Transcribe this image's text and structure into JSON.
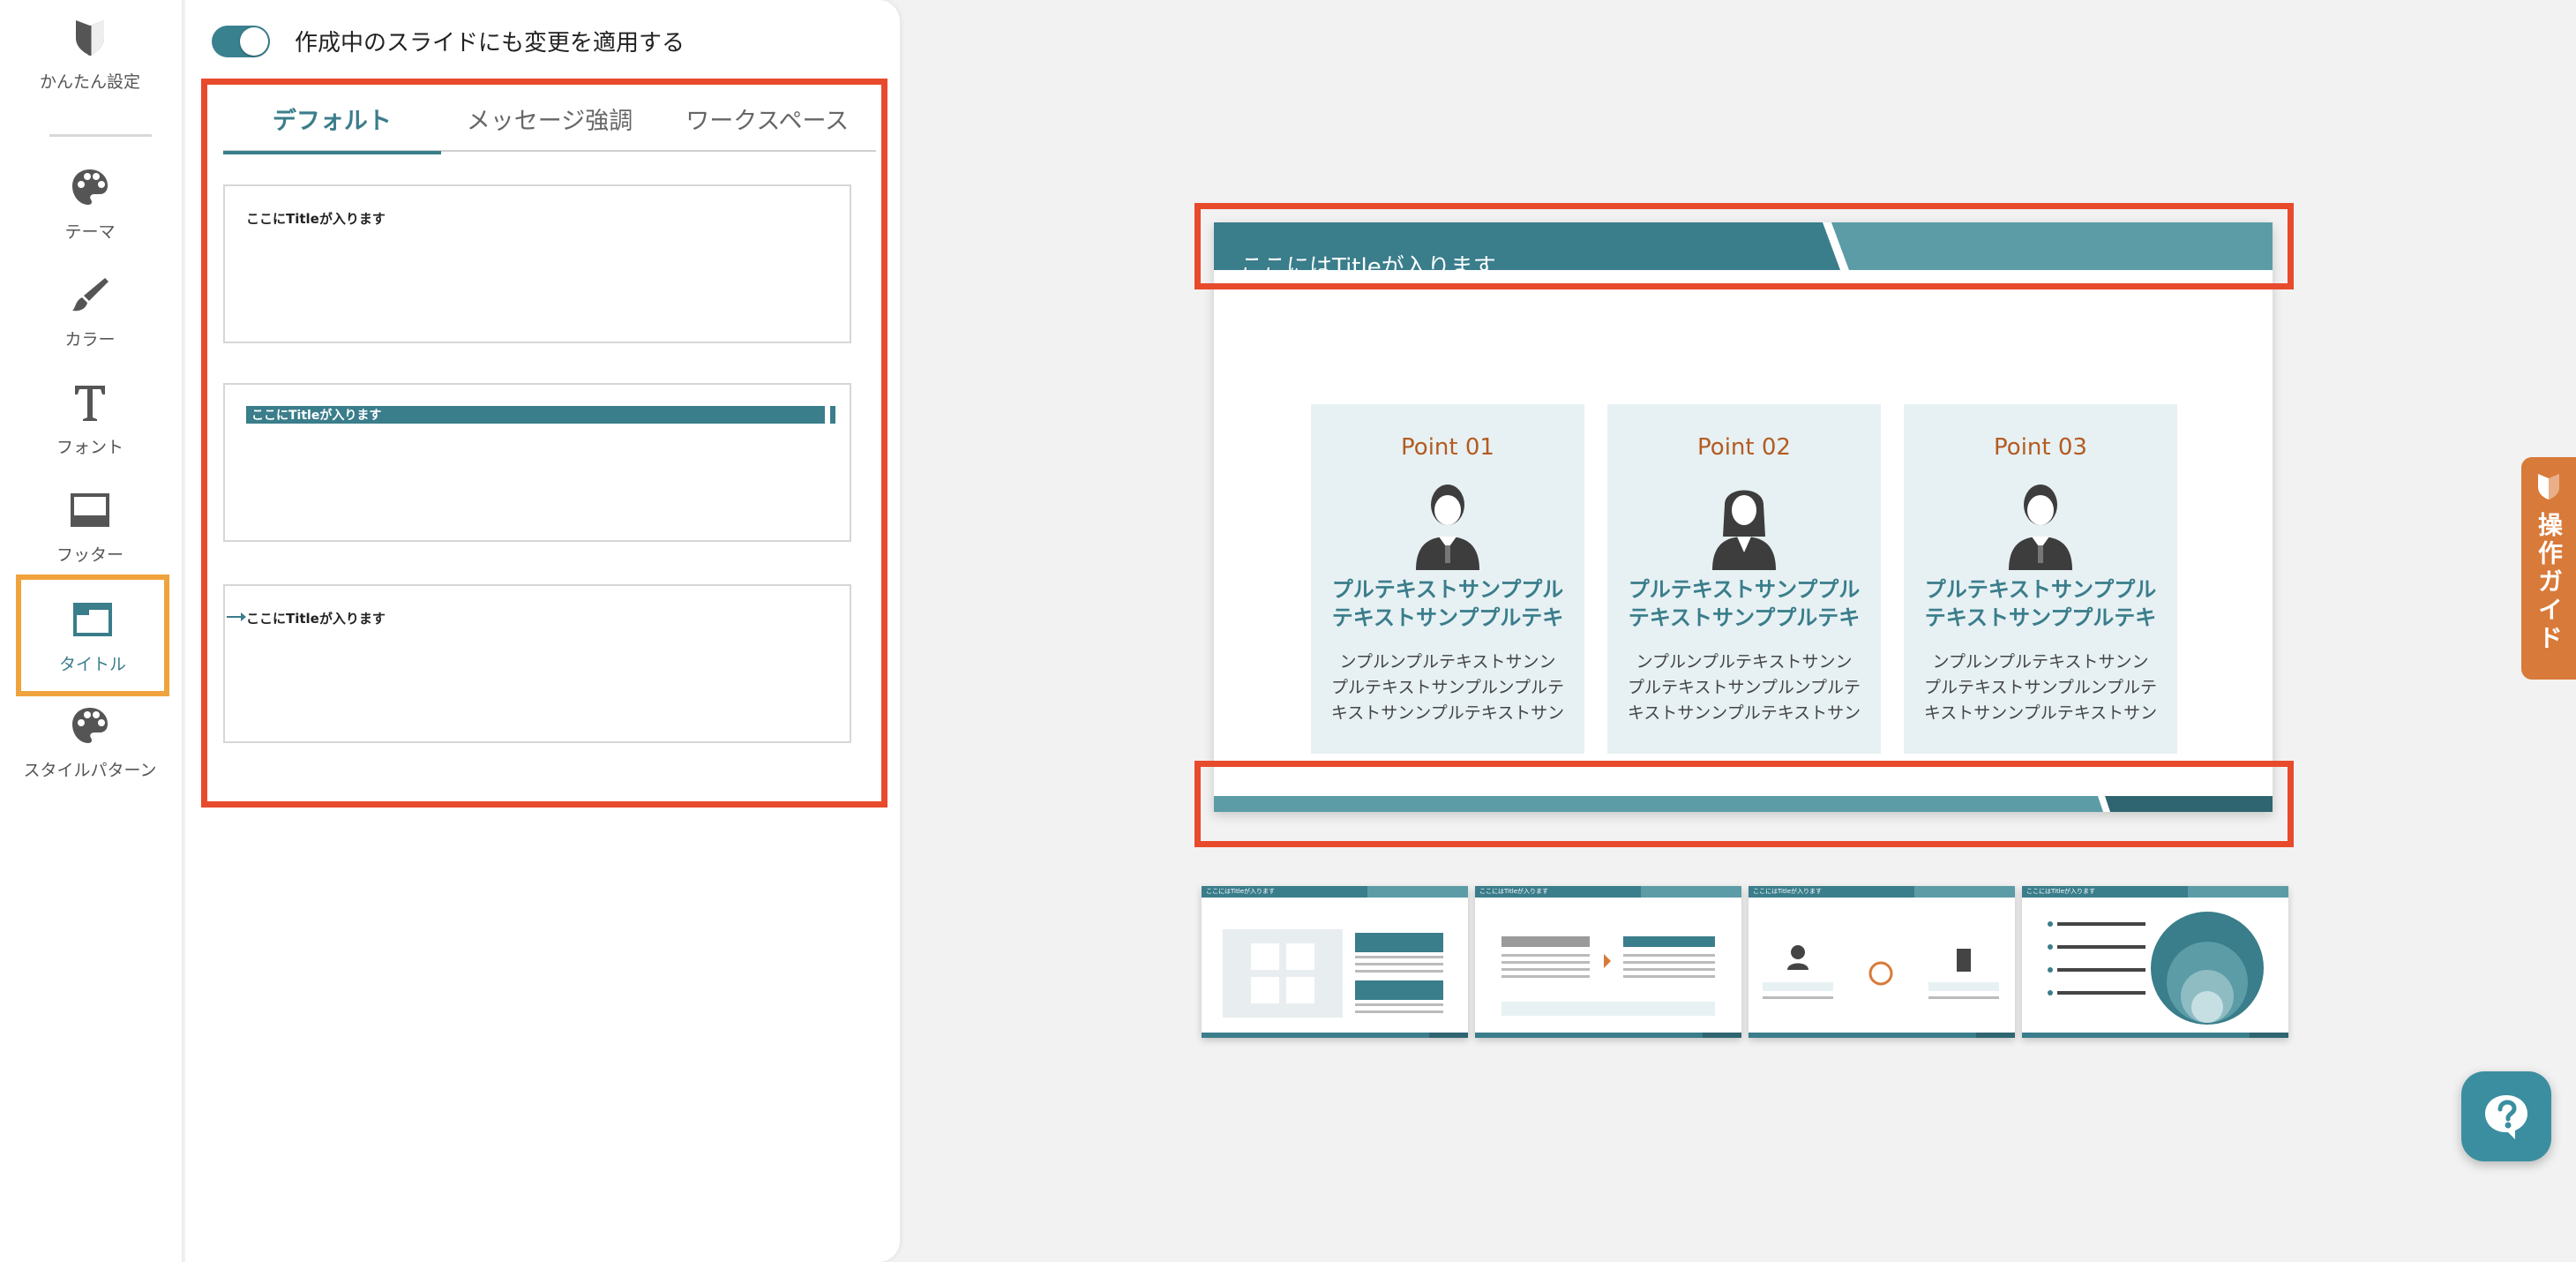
{
  "sidebar": {
    "items": [
      {
        "label": "かんたん設定",
        "icon": "shield-icon"
      },
      {
        "label": "テーマ",
        "icon": "palette-icon"
      },
      {
        "label": "カラー",
        "icon": "brush-icon"
      },
      {
        "label": "フォント",
        "icon": "font-icon"
      },
      {
        "label": "フッター",
        "icon": "footer-icon"
      },
      {
        "label": "タイトル",
        "icon": "title-layout-icon",
        "active": true
      },
      {
        "label": "スタイルパターン",
        "icon": "palette-icon"
      }
    ]
  },
  "panel": {
    "apply_label": "作成中のスライドにも変更を適用する",
    "apply_on": true,
    "tabs": [
      "デフォルト",
      "メッセージ強調",
      "ワークスペース"
    ],
    "active_tab": 0,
    "options": [
      {
        "title": "ここにTitleが入ります"
      },
      {
        "title": "ここにTitleが入ります"
      },
      {
        "title": "ここにTitleが入ります"
      }
    ]
  },
  "slide": {
    "title": "ここにはTitleが入ります",
    "cards": [
      {
        "point": "Point 01",
        "head": "プルテキストサンププル\nテキストサンププルテキ",
        "body": "ンプルンプルテキストサンン\nプルテキストサンプルンプルテ\nキストサンンプルテキストサン",
        "gender": "male"
      },
      {
        "point": "Point 02",
        "head": "プルテキストサンププル\nテキストサンププルテキ",
        "body": "ンプルンプルテキストサンン\nプルテキストサンプルンプルテ\nキストサンンプルテキストサン",
        "gender": "female"
      },
      {
        "point": "Point 03",
        "head": "プルテキストサンププル\nテキストサンププルテキ",
        "body": "ンプルンプルテキストサンン\nプルテキストサンプルンプルテ\nキストサンンプルテキストサン",
        "gender": "male"
      }
    ]
  },
  "thumbnails": [
    {
      "title": "ここにはTitleが入ります"
    },
    {
      "title": "ここにはTitleが入ります"
    },
    {
      "title": "ここにはTitleが入ります"
    },
    {
      "title": "ここにはTitleが入ります"
    }
  ],
  "guide": {
    "label": "操作ガイド"
  },
  "help": {
    "icon": "question-chat-icon"
  },
  "colors": {
    "accent": "#3a7d8b",
    "highlight": "#e84a2c",
    "active_nav": "#f0a33c",
    "point": "#b35b22",
    "guide": "#d87a39"
  }
}
